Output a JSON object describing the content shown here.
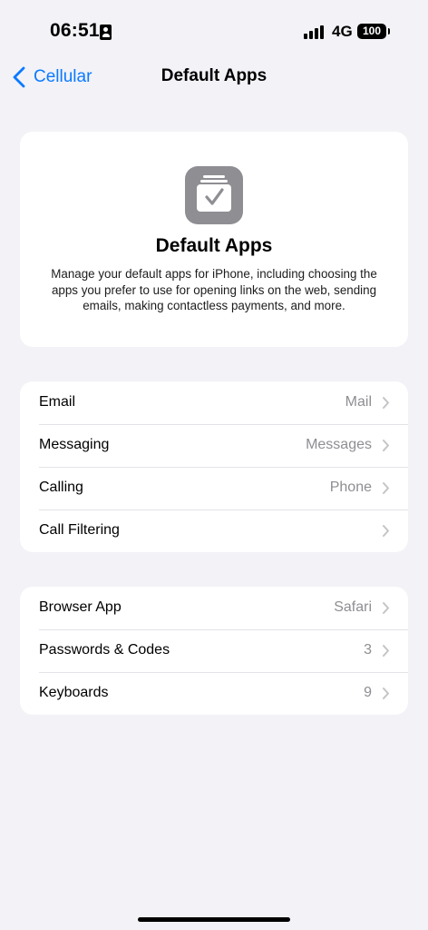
{
  "status_bar": {
    "time": "06:51",
    "network": "4G",
    "battery": "100"
  },
  "nav": {
    "back_label": "Cellular",
    "title": "Default Apps"
  },
  "hero": {
    "icon": "checkmark-stack-icon",
    "title": "Default Apps",
    "description": "Manage your default apps for iPhone, including choosing the apps you prefer to use for opening links on the web, sending emails, making contactless payments, and more."
  },
  "group1": [
    {
      "label": "Email",
      "value": "Mail"
    },
    {
      "label": "Messaging",
      "value": "Messages"
    },
    {
      "label": "Calling",
      "value": "Phone"
    },
    {
      "label": "Call Filtering",
      "value": ""
    }
  ],
  "group2": [
    {
      "label": "Browser App",
      "value": "Safari"
    },
    {
      "label": "Passwords & Codes",
      "value": "3"
    },
    {
      "label": "Keyboards",
      "value": "9"
    }
  ],
  "colors": {
    "accent": "#0a7aff",
    "background": "#f2f2f7",
    "secondary_text": "#8e8e93"
  }
}
